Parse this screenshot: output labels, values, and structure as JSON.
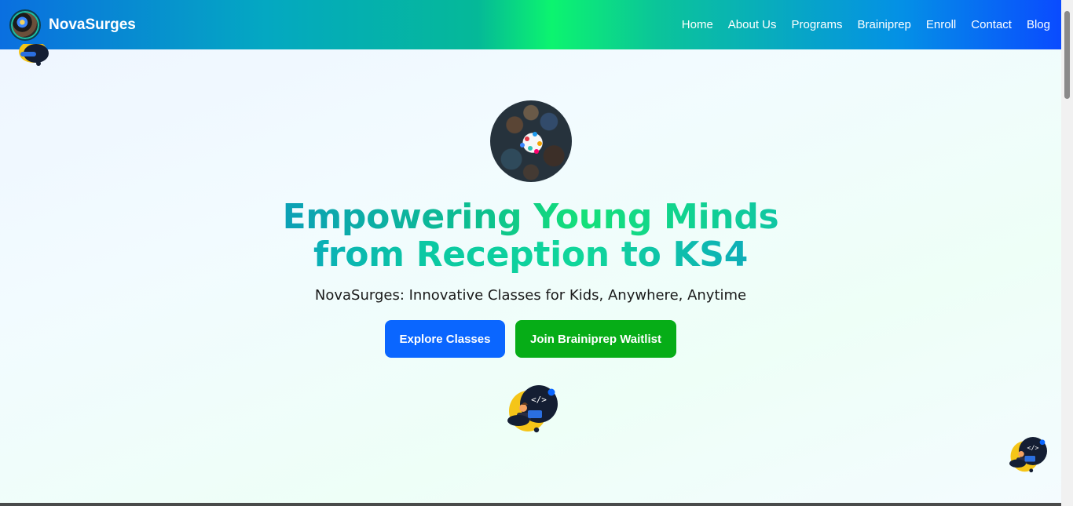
{
  "nav": {
    "brand": "NovaSurges",
    "links": [
      "Home",
      "About Us",
      "Programs",
      "Brainiprep",
      "Enroll",
      "Contact",
      "Blog"
    ]
  },
  "hero": {
    "title_line_1": "Empowering Young Minds",
    "title_line_2": "from Reception to KS4",
    "subtitle": "NovaSurges: Innovative Classes for Kids, Anywhere, Anytime",
    "primary_button": "Explore Classes",
    "secondary_button": "Join Brainiprep Waitlist"
  },
  "icons": {
    "code_glyph": "</>",
    "coder_icon": "coder-illustration-icon",
    "logo": "novasurges-logo-icon"
  },
  "colors": {
    "primary_button": "#0a66ff",
    "secondary_button": "#06ad17",
    "nav_gradient_start": "#0a6fe0",
    "nav_gradient_mid": "#0cf46f",
    "nav_gradient_end": "#0a4bff"
  }
}
